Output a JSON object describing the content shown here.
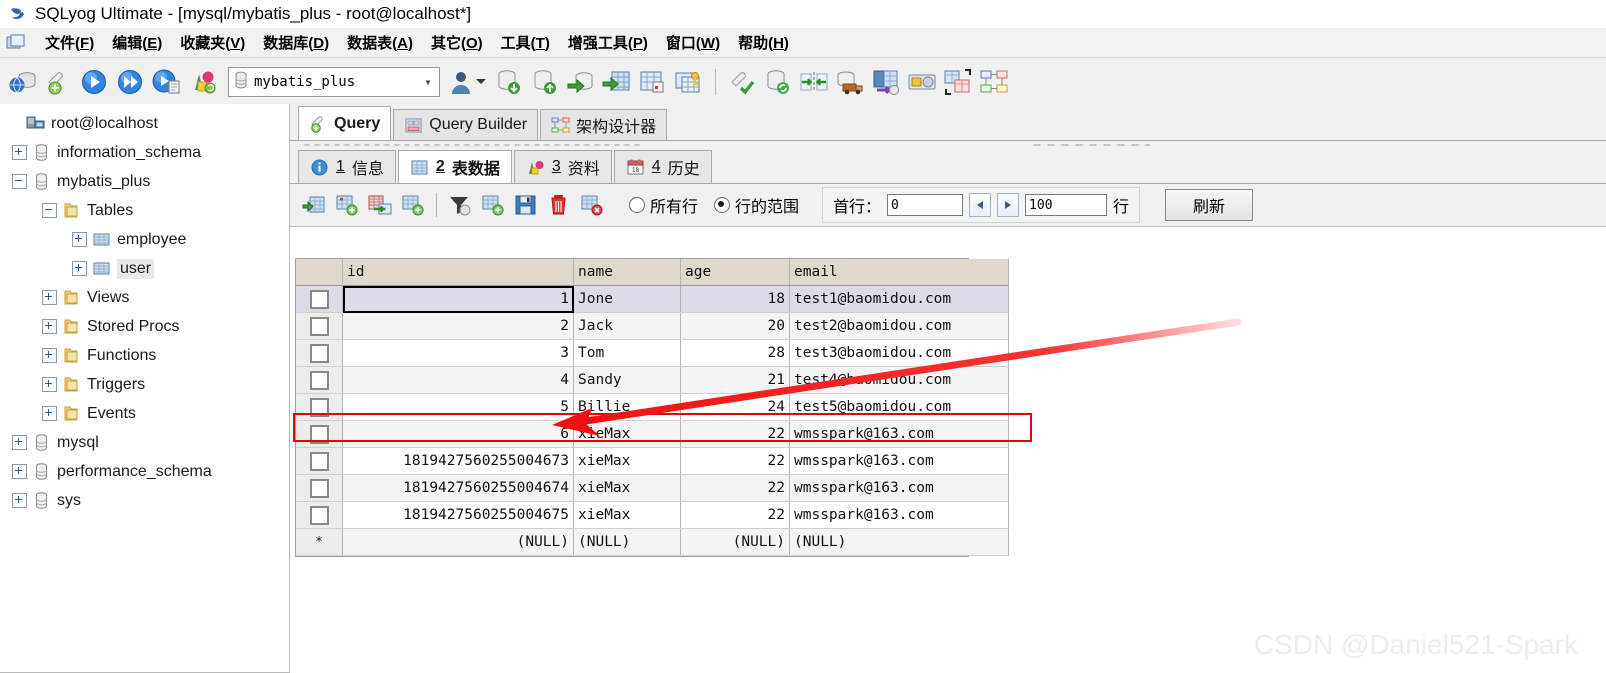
{
  "window": {
    "title": "SQLyog Ultimate - [mysql/mybatis_plus - root@localhost*]",
    "app_icon": "sqlyog-dolphin-icon"
  },
  "menubar": {
    "app_icon": "window-system-icon",
    "items": [
      {
        "label": "文件",
        "mnemonic": "F"
      },
      {
        "label": "编辑",
        "mnemonic": "E"
      },
      {
        "label": "收藏夹",
        "mnemonic": "V"
      },
      {
        "label": "数据库",
        "mnemonic": "D"
      },
      {
        "label": "数据表",
        "mnemonic": "A"
      },
      {
        "label": "其它",
        "mnemonic": "O"
      },
      {
        "label": "工具",
        "mnemonic": "T"
      },
      {
        "label": "增强工具",
        "mnemonic": "P"
      },
      {
        "label": "窗口",
        "mnemonic": "W"
      },
      {
        "label": "帮助",
        "mnemonic": "H"
      }
    ]
  },
  "toolbar": {
    "buttons_left": [
      "new-connection-icon",
      "new-query-tab-icon",
      "execute-query-icon",
      "execute-all-queries-icon",
      "execute-query-new-tab-icon",
      "chart-data-icon"
    ],
    "db_selector": {
      "icon": "database-icon",
      "value": "mybatis_plus",
      "chevron": "chevron-down-icon"
    },
    "user_button": "user-manager-icon",
    "buttons_right": [
      "backup-database-icon",
      "restore-database-icon",
      "import-data-icon",
      "export-table-icon",
      "table-diagnostics-icon",
      "table-keys-icon",
      "sql-formatter-icon",
      "sync-database-icon",
      "schema-sync-icon",
      "data-transfer-icon",
      "migrate-data-icon",
      "notes-icon",
      "table-compare-icon",
      "schema-designer-icon"
    ]
  },
  "sidebar": {
    "items": [
      {
        "label": "root@localhost",
        "icon": "host-connection-icon",
        "indent": 0,
        "expander": "none",
        "selected": false
      },
      {
        "label": "information_schema",
        "icon": "database-icon",
        "indent": 1,
        "expander": "plus",
        "selected": false
      },
      {
        "label": "mybatis_plus",
        "icon": "database-icon",
        "indent": 1,
        "expander": "minus",
        "selected": false
      },
      {
        "label": "Tables",
        "icon": "folder-icon",
        "indent": 2,
        "expander": "minus",
        "selected": false
      },
      {
        "label": "employee",
        "icon": "table-icon",
        "indent": 3,
        "expander": "plus",
        "selected": false
      },
      {
        "label": "user",
        "icon": "table-icon",
        "indent": 3,
        "expander": "plus",
        "selected": true
      },
      {
        "label": "Views",
        "icon": "folder-icon",
        "indent": 2,
        "expander": "plus",
        "selected": false
      },
      {
        "label": "Stored Procs",
        "icon": "folder-icon",
        "indent": 2,
        "expander": "plus",
        "selected": false
      },
      {
        "label": "Functions",
        "icon": "folder-icon",
        "indent": 2,
        "expander": "plus",
        "selected": false
      },
      {
        "label": "Triggers",
        "icon": "folder-icon",
        "indent": 2,
        "expander": "plus",
        "selected": false
      },
      {
        "label": "Events",
        "icon": "folder-icon",
        "indent": 2,
        "expander": "plus",
        "selected": false
      },
      {
        "label": "mysql",
        "icon": "database-icon",
        "indent": 1,
        "expander": "plus",
        "selected": false
      },
      {
        "label": "performance_schema",
        "icon": "database-icon",
        "indent": 1,
        "expander": "plus",
        "selected": false
      },
      {
        "label": "sys",
        "icon": "database-icon",
        "indent": 1,
        "expander": "plus",
        "selected": false
      }
    ]
  },
  "main": {
    "tabs": [
      {
        "label": "Query",
        "icon": "query-icon",
        "active": true
      },
      {
        "label": "Query Builder",
        "icon": "query-builder-icon",
        "active": false
      },
      {
        "label": "架构设计器",
        "icon": "schema-designer-icon",
        "active": false
      }
    ],
    "subtabs": [
      {
        "num": "1",
        "label": "信息",
        "icon": "info-icon",
        "active": false
      },
      {
        "num": "2",
        "label": "表数据",
        "icon": "table-data-icon",
        "active": true
      },
      {
        "num": "3",
        "label": "资料",
        "icon": "chart-icon",
        "active": false
      },
      {
        "num": "4",
        "label": "历史",
        "icon": "calendar-history-icon",
        "active": false
      }
    ],
    "gridbar": {
      "buttons": [
        "insert-row-icon",
        "duplicate-row-icon",
        "edit-row-icon",
        "add-row-icon",
        "filter-icon",
        "new-record-icon",
        "save-changes-icon",
        "delete-row-icon",
        "discard-changes-icon"
      ],
      "radios": [
        {
          "label": "所有行",
          "selected": false
        },
        {
          "label": "行的范围",
          "selected": true
        }
      ],
      "first_row_label": "首行：",
      "first_row_value": "0",
      "prev_icon": "prev-page-icon",
      "next_icon": "next-page-icon",
      "count_value": "100",
      "rows_unit_label": "行",
      "refresh_label": "刷新"
    }
  },
  "grid": {
    "columns": [
      "id",
      "name",
      "age",
      "email"
    ],
    "rows": [
      {
        "id": "1",
        "name": "Jone",
        "age": "18",
        "email": "test1@baomidou.com"
      },
      {
        "id": "2",
        "name": "Jack",
        "age": "20",
        "email": "test2@baomidou.com"
      },
      {
        "id": "3",
        "name": "Tom",
        "age": "28",
        "email": "test3@baomidou.com"
      },
      {
        "id": "4",
        "name": "Sandy",
        "age": "21",
        "email": "test4@baomidou.com"
      },
      {
        "id": "5",
        "name": "Billie",
        "age": "24",
        "email": "test5@baomidou.com"
      },
      {
        "id": "6",
        "name": "xieMax",
        "age": "22",
        "email": "wmsspark@163.com"
      },
      {
        "id": "1819427560255004673",
        "name": "xieMax",
        "age": "22",
        "email": "wmsspark@163.com"
      },
      {
        "id": "1819427560255004674",
        "name": "xieMax",
        "age": "22",
        "email": "wmsspark@163.com"
      },
      {
        "id": "1819427560255004675",
        "name": "xieMax",
        "age": "22",
        "email": "wmsspark@163.com"
      }
    ],
    "new_row": {
      "marker": "*",
      "id": "(NULL)",
      "name": "(NULL)",
      "age": "(NULL)",
      "email": "(NULL)"
    }
  },
  "annotations": {
    "highlight_color": "#e8000b",
    "arrow_color": "#f01010",
    "highlighted_row_id": "6"
  },
  "watermark": {
    "text": "CSDN @Daniel521-Spark"
  }
}
